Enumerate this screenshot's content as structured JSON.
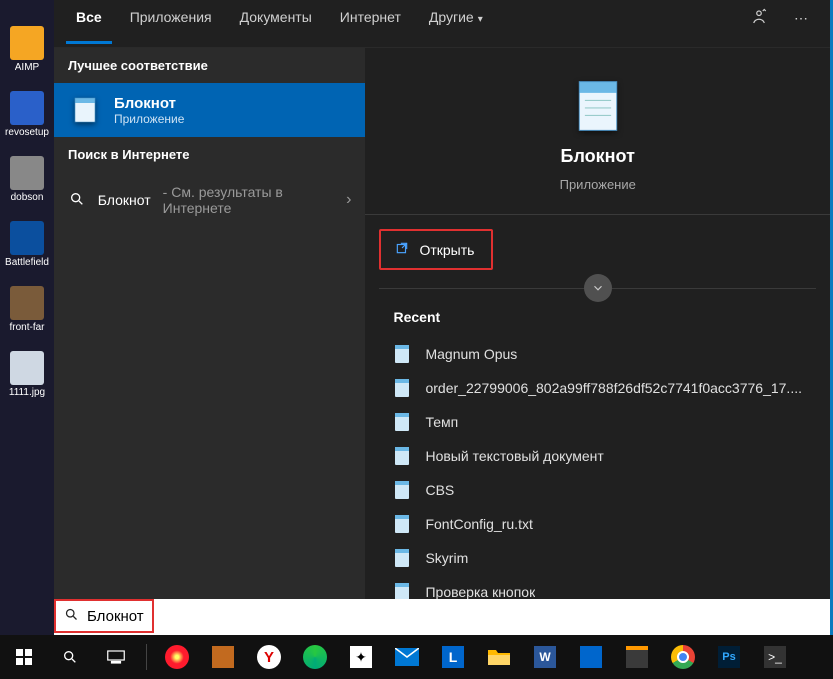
{
  "desktop": {
    "icons": [
      {
        "label": "AIMP",
        "color": "#f5a623"
      },
      {
        "label": "revosetup",
        "color": "#2a60c9"
      },
      {
        "label": "dobson",
        "color": "#888888"
      },
      {
        "label": "Battlefield",
        "color": "#0b4f9e"
      },
      {
        "label": "front-far",
        "color": "#7a5b3a"
      },
      {
        "label": "1111.jpg",
        "color": "#cfd8e3"
      }
    ]
  },
  "tabs": {
    "items": [
      {
        "label": "Все",
        "active": true
      },
      {
        "label": "Приложения",
        "active": false
      },
      {
        "label": "Документы",
        "active": false
      },
      {
        "label": "Интернет",
        "active": false
      },
      {
        "label": "Другие",
        "active": false,
        "dropdown": true
      }
    ],
    "feedback_icon": "feedback-icon",
    "more_icon": "more-icon"
  },
  "left": {
    "best_match_label": "Лучшее соответствие",
    "best_match": {
      "title": "Блокнот",
      "subtitle": "Приложение"
    },
    "web_label": "Поиск в Интернете",
    "web_item": {
      "name": "Блокнот",
      "suffix": " - См. результаты в Интернете"
    }
  },
  "preview": {
    "title": "Блокнот",
    "subtitle": "Приложение",
    "open_label": "Открыть",
    "recent_label": "Recent",
    "recent": [
      "Magnum Opus",
      "order_22799006_802a99ff788f26df52c7741f0acc3776_17....",
      "Темп",
      "Новый текстовый документ",
      "CBS",
      "FontConfig_ru.txt",
      "Skyrim",
      "Проверка кнопок"
    ]
  },
  "search": {
    "value": "Блокнот"
  },
  "taskbar": {
    "items": [
      {
        "name": "start-icon",
        "color": "#ffffff"
      },
      {
        "name": "search-icon",
        "color": "#ffffff"
      },
      {
        "name": "task-view-icon",
        "color": "#ffffff"
      },
      {
        "name": "divider"
      },
      {
        "name": "opera-icon",
        "color": "#ff1b2d"
      },
      {
        "name": "app1-icon",
        "color": "#c26a1f"
      },
      {
        "name": "yandex-icon",
        "color": "#ffcc00"
      },
      {
        "name": "disc-icon",
        "color": "#28c840"
      },
      {
        "name": "stars-icon",
        "color": "#ffffff"
      },
      {
        "name": "mail-icon",
        "color": "#0078d4"
      },
      {
        "name": "lingvo-icon",
        "color": "#0066cc"
      },
      {
        "name": "explorer-icon",
        "color": "#ffb900"
      },
      {
        "name": "word-icon",
        "color": "#2b579a"
      },
      {
        "name": "notes-icon",
        "color": "#0066cc"
      },
      {
        "name": "sublime-icon",
        "color": "#ff9800"
      },
      {
        "name": "chrome-icon",
        "color": "#4285f4"
      },
      {
        "name": "photoshop-icon",
        "color": "#001e36"
      },
      {
        "name": "terminal-icon",
        "color": "#333333"
      }
    ]
  }
}
